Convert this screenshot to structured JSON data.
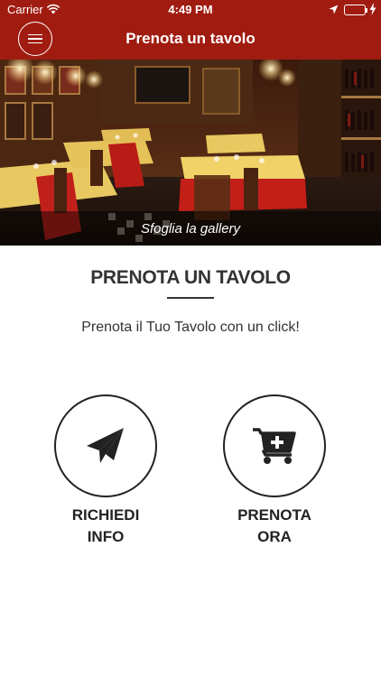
{
  "status_bar": {
    "carrier": "Carrier",
    "time": "4:49 PM",
    "battery_level": 1.0,
    "battery_color": "#4cd964",
    "icons": [
      "wifi-icon",
      "location-arrow-icon",
      "battery-icon",
      "charging-bolt-icon"
    ]
  },
  "nav": {
    "title": "Prenota un tavolo",
    "menu_icon": "hamburger-menu-icon",
    "bar_color": "#a01c10"
  },
  "hero": {
    "gallery_label": "Sfoglia la gallery"
  },
  "content": {
    "title": "PRENOTA UN TAVOLO",
    "subtitle": "Prenota il Tuo Tavolo con un click!"
  },
  "actions": [
    {
      "label": "RICHIEDI\nINFO",
      "icon": "paper-plane-icon"
    },
    {
      "label": "PRENOTA\nORA",
      "icon": "cart-plus-icon"
    }
  ]
}
